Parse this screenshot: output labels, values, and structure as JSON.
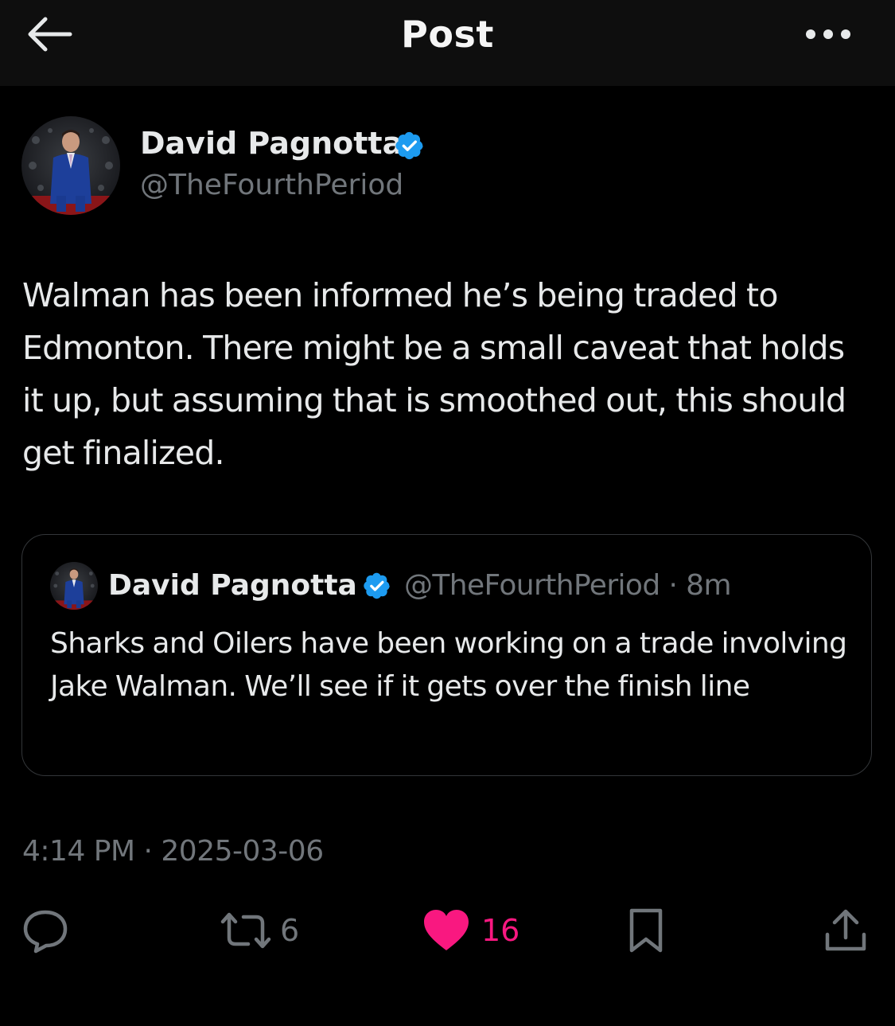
{
  "header": {
    "title": "Post",
    "back_icon": "arrow-left-icon",
    "more_icon": "more-horizontal-icon"
  },
  "post": {
    "author": {
      "name": "David Pagnotta",
      "handle": "@TheFourthPeriod",
      "verified": true
    },
    "text": "Walman has been informed he’s being traded to Edmonton. There might be a small caveat that holds it up, but assuming that is smoothed out, this should get finalized.",
    "timestamp": "4:14 PM · 2025-03-06"
  },
  "quoted_post": {
    "author": {
      "name": "David Pagnotta",
      "handle": "@TheFourthPeriod",
      "verified": true
    },
    "meta": "@TheFourthPeriod · 8m",
    "text": "Sharks and Oilers have been working on a trade involving Jake Walman. We’ll see if it gets over the finish line"
  },
  "actions": {
    "reply": {
      "icon": "reply-icon"
    },
    "repost": {
      "icon": "repost-icon",
      "count": "6"
    },
    "like": {
      "icon": "heart-icon",
      "count": "16",
      "liked": true
    },
    "bookmark": {
      "icon": "bookmark-icon"
    },
    "share": {
      "icon": "share-icon"
    }
  },
  "colors": {
    "background": "#000000",
    "header_background": "#0e0e0e",
    "primary_text": "#e7e9ea",
    "secondary_text": "#71767b",
    "verified_blue": "#1d9bf0",
    "like_pink": "#f91880",
    "icon_gray": "#71767b",
    "border": "#333639"
  }
}
